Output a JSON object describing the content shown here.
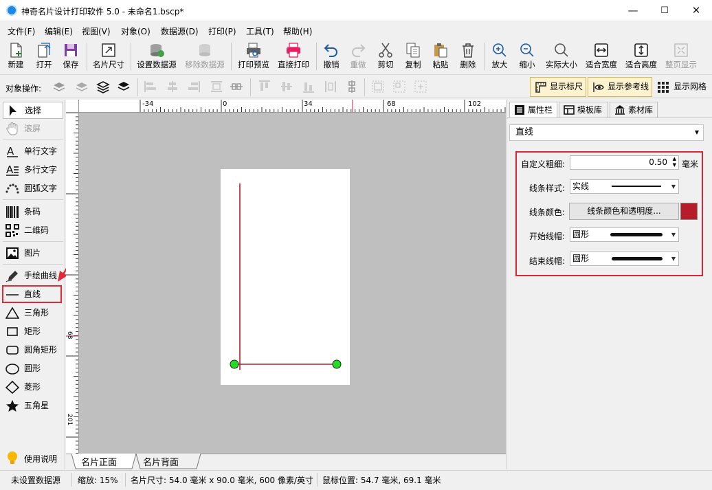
{
  "window": {
    "title": "神奇名片设计打印软件 5.0 - 未命名1.bscp*",
    "minimize": "—",
    "maximize": "☐",
    "close": "✕"
  },
  "menu": [
    "文件(F)",
    "编辑(E)",
    "视图(V)",
    "对象(O)",
    "数据源(D)",
    "打印(P)",
    "工具(T)",
    "帮助(H)"
  ],
  "toolbar": [
    {
      "id": "new",
      "label": "新建",
      "icon": "new-file-icon",
      "enabled": true
    },
    {
      "id": "open",
      "label": "打开",
      "icon": "open-icon",
      "enabled": true
    },
    {
      "id": "save",
      "label": "保存",
      "icon": "save-icon",
      "enabled": true
    },
    {
      "id": "card-size",
      "label": "名片尺寸",
      "icon": "resize-icon",
      "enabled": true
    },
    {
      "id": "set-datasource",
      "label": "设置数据源",
      "icon": "database-icon",
      "enabled": true
    },
    {
      "id": "remove-datasource",
      "label": "移除数据源",
      "icon": "database-remove-icon",
      "enabled": false
    },
    {
      "id": "print-preview",
      "label": "打印预览",
      "icon": "print-preview-icon",
      "enabled": true
    },
    {
      "id": "print",
      "label": "直接打印",
      "icon": "printer-icon",
      "enabled": true
    },
    {
      "id": "undo",
      "label": "撤销",
      "icon": "undo-icon",
      "enabled": true
    },
    {
      "id": "redo",
      "label": "重做",
      "icon": "redo-icon",
      "enabled": false
    },
    {
      "id": "cut",
      "label": "剪切",
      "icon": "scissors-icon",
      "enabled": true
    },
    {
      "id": "copy",
      "label": "复制",
      "icon": "copy-icon",
      "enabled": true
    },
    {
      "id": "paste",
      "label": "粘贴",
      "icon": "paste-icon",
      "enabled": true
    },
    {
      "id": "delete",
      "label": "删除",
      "icon": "trash-icon",
      "enabled": true
    },
    {
      "id": "zoom-in",
      "label": "放大",
      "icon": "zoom-in-icon",
      "enabled": true
    },
    {
      "id": "zoom-out",
      "label": "缩小",
      "icon": "zoom-out-icon",
      "enabled": true
    },
    {
      "id": "actual-size",
      "label": "实际大小",
      "icon": "magnifier-icon",
      "enabled": true
    },
    {
      "id": "fit-width",
      "label": "适合宽度",
      "icon": "fit-width-icon",
      "enabled": true
    },
    {
      "id": "fit-height",
      "label": "适合高度",
      "icon": "fit-height-icon",
      "enabled": true
    },
    {
      "id": "full-page",
      "label": "整页显示",
      "icon": "full-page-icon",
      "enabled": false
    }
  ],
  "ops": {
    "label": "对象操作:",
    "show_ruler": "显示标尺",
    "show_guides": "显示参考线",
    "show_grid": "显示网格"
  },
  "tools": [
    {
      "id": "select",
      "label": "选择",
      "icon": "pointer-icon",
      "selected": true,
      "enabled": true
    },
    {
      "id": "scroll",
      "label": "滚屏",
      "icon": "hand-icon",
      "selected": false,
      "enabled": false
    },
    {
      "id": "single-text",
      "label": "单行文字",
      "icon": "single-text-icon",
      "selected": false,
      "enabled": true
    },
    {
      "id": "multi-text",
      "label": "多行文字",
      "icon": "multi-text-icon",
      "selected": false,
      "enabled": true
    },
    {
      "id": "arc-text",
      "label": "圆弧文字",
      "icon": "arc-text-icon",
      "selected": false,
      "enabled": true
    },
    {
      "id": "barcode",
      "label": "条码",
      "icon": "barcode-icon",
      "selected": false,
      "enabled": true
    },
    {
      "id": "qrcode",
      "label": "二维码",
      "icon": "qrcode-icon",
      "selected": false,
      "enabled": true
    },
    {
      "id": "image",
      "label": "图片",
      "icon": "image-icon",
      "selected": false,
      "enabled": true
    },
    {
      "id": "freehand",
      "label": "手绘曲线",
      "icon": "pen-icon",
      "selected": false,
      "enabled": true
    },
    {
      "id": "line",
      "label": "直线",
      "icon": "line-icon",
      "selected": false,
      "enabled": true,
      "highlighted": true
    },
    {
      "id": "triangle",
      "label": "三角形",
      "icon": "triangle-icon",
      "selected": false,
      "enabled": true
    },
    {
      "id": "rect",
      "label": "矩形",
      "icon": "rectangle-icon",
      "selected": false,
      "enabled": true
    },
    {
      "id": "round-rect",
      "label": "圆角矩形",
      "icon": "rounded-rectangle-icon",
      "selected": false,
      "enabled": true
    },
    {
      "id": "ellipse",
      "label": "圆形",
      "icon": "circle-icon",
      "selected": false,
      "enabled": true
    },
    {
      "id": "diamond",
      "label": "菱形",
      "icon": "diamond-icon",
      "selected": false,
      "enabled": true
    },
    {
      "id": "star",
      "label": "五角星",
      "icon": "star-icon",
      "selected": false,
      "enabled": true
    }
  ],
  "help": {
    "label": "使用说明",
    "icon": "lightbulb-icon"
  },
  "ruler": {
    "top_labels": [
      "-34",
      "0",
      "34",
      "68",
      "102"
    ],
    "left_labels": [
      "68",
      "201"
    ]
  },
  "page_tabs": [
    "名片正面",
    "名片背面"
  ],
  "right": {
    "tabs": [
      "属性栏",
      "模板库",
      "素材库"
    ],
    "object_type": "直线",
    "props": {
      "width_label": "自定义粗细:",
      "width_value": "0.50",
      "width_unit": "毫米",
      "style_label": "线条样式:",
      "style_value": "实线",
      "color_label": "线条颜色:",
      "color_button": "线条颜色和透明度...",
      "color_value": "#b71c2b",
      "start_cap_label": "开始线帽:",
      "start_cap_value": "圆形",
      "end_cap_label": "结束线帽:",
      "end_cap_value": "圆形"
    }
  },
  "status": {
    "datasource": "未设置数据源",
    "zoom": "缩放: 15%",
    "card_size": "名片尺寸: 54.0 毫米 x 90.0 毫米, 600 像素/英寸",
    "mouse_pos": "鼠标位置: 54.7 毫米, 69.1 毫米"
  },
  "colors": {
    "accent_red": "#e02a3a",
    "line_color": "#b71c2b",
    "handle_green": "#22dd22"
  }
}
